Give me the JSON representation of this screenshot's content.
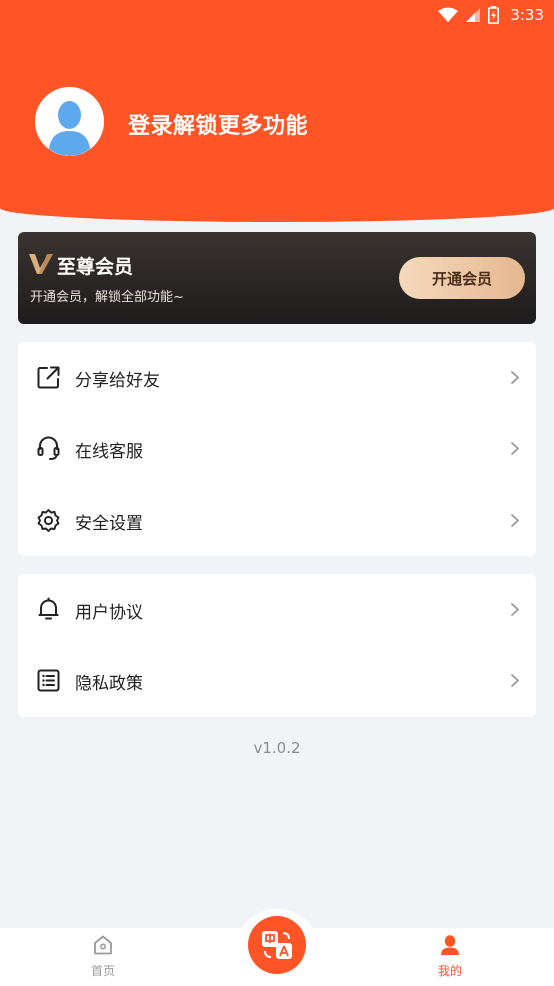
{
  "status_bar": {
    "time": "3:33"
  },
  "profile": {
    "login_prompt": "登录解锁更多功能"
  },
  "vip": {
    "title": "至尊会员",
    "description": "开通会员，解锁全部功能~",
    "button_label": "开通会员"
  },
  "menu_group_1": [
    {
      "label": "分享给好友",
      "icon": "share-icon"
    },
    {
      "label": "在线客服",
      "icon": "headset-icon"
    },
    {
      "label": "安全设置",
      "icon": "gear-icon"
    }
  ],
  "menu_group_2": [
    {
      "label": "用户协议",
      "icon": "bell-icon"
    },
    {
      "label": "隐私政策",
      "icon": "list-icon"
    }
  ],
  "version": "v1.0.2",
  "tabbar": {
    "home_label": "首页",
    "translate_icon": "translate-icon",
    "mine_label": "我的"
  },
  "colors": {
    "brand": "#FF5526",
    "background": "#F2F3F7",
    "vip_gold": "#E5B88F"
  }
}
